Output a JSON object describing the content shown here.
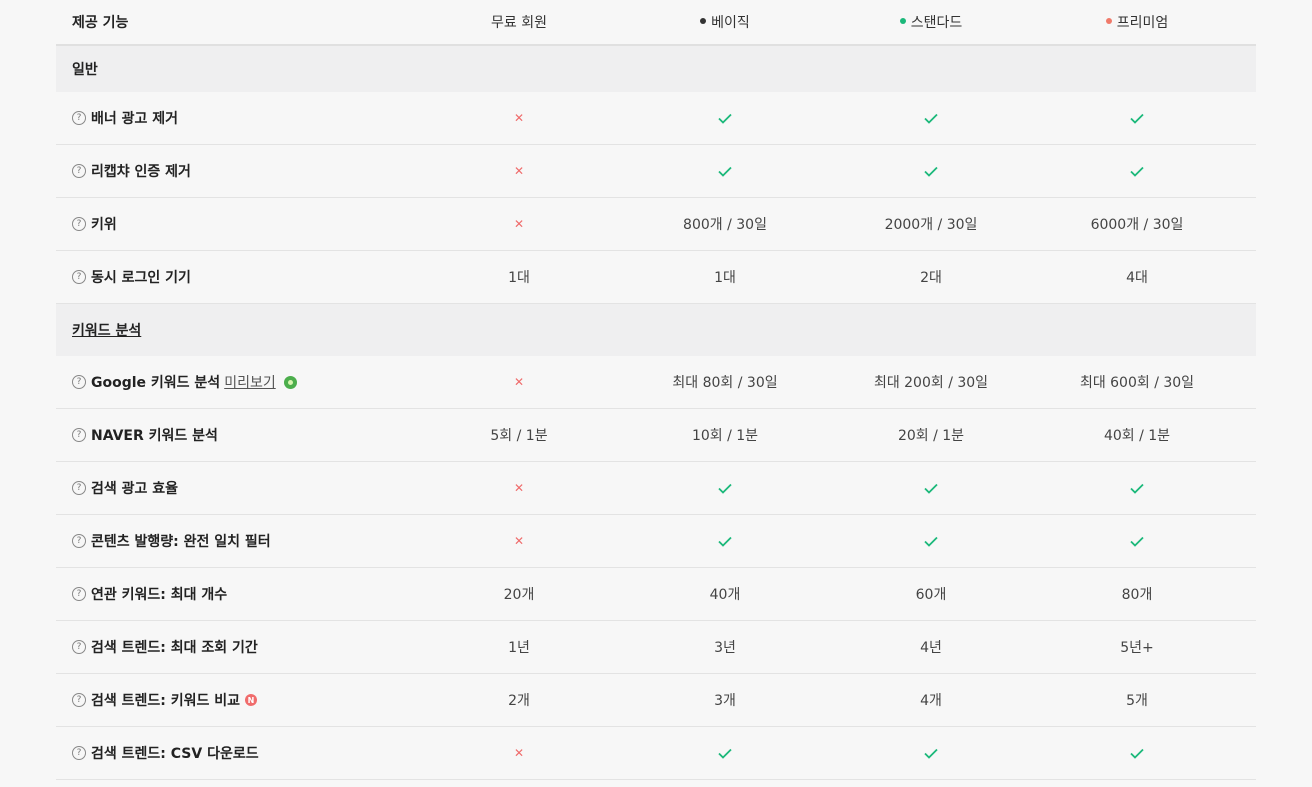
{
  "header": {
    "feature_label": "제공 기능",
    "plans": [
      {
        "name": "무료 회원",
        "dot_color": ""
      },
      {
        "name": "베이직",
        "dot_color": "#333333"
      },
      {
        "name": "스탠다드",
        "dot_color": "#1bb87a"
      },
      {
        "name": "프리미엄",
        "dot_color": "#f07a6a"
      }
    ]
  },
  "colors": {
    "check": "#1bb87a",
    "cross": "#ef6b6b"
  },
  "sections": [
    {
      "title": "일반",
      "rows": [
        {
          "label": "배너 광고 제거",
          "values": [
            "x",
            "check",
            "check",
            "check"
          ]
        },
        {
          "label": "리캡챠 인증 제거",
          "values": [
            "x",
            "check",
            "check",
            "check"
          ]
        },
        {
          "label": "키위",
          "values": [
            "x",
            "800개 / 30일",
            "2000개 / 30일",
            "6000개 / 30일"
          ]
        },
        {
          "label": "동시 로그인 기기",
          "values": [
            "1대",
            "1대",
            "2대",
            "4대"
          ]
        }
      ]
    },
    {
      "title": "키워드 분석",
      "rows": [
        {
          "label": "Google 키워드 분석",
          "link": "미리보기",
          "badge": "google-badge",
          "values": [
            "x",
            "최대 80회 / 30일",
            "최대 200회 / 30일",
            "최대 600회 / 30일"
          ]
        },
        {
          "label": "NAVER 키워드 분석",
          "values": [
            "5회 / 1분",
            "10회 / 1분",
            "20회 / 1분",
            "40회 / 1분"
          ]
        },
        {
          "label": "검색 광고 효율",
          "values": [
            "x",
            "check",
            "check",
            "check"
          ]
        },
        {
          "label": "콘텐츠 발행량: 완전 일치 필터",
          "values": [
            "x",
            "check",
            "check",
            "check"
          ]
        },
        {
          "label": "연관 키워드: 최대 개수",
          "values": [
            "20개",
            "40개",
            "60개",
            "80개"
          ]
        },
        {
          "label": "검색 트렌드: 최대 조회 기간",
          "values": [
            "1년",
            "3년",
            "4년",
            "5년+"
          ]
        },
        {
          "label": "검색 트렌드: 키워드 비교",
          "badge": "new-badge",
          "badge_text": "N",
          "values": [
            "2개",
            "3개",
            "4개",
            "5개"
          ]
        },
        {
          "label": "검색 트렌드: CSV 다운로드",
          "values": [
            "x",
            "check",
            "check",
            "check"
          ]
        }
      ]
    }
  ]
}
